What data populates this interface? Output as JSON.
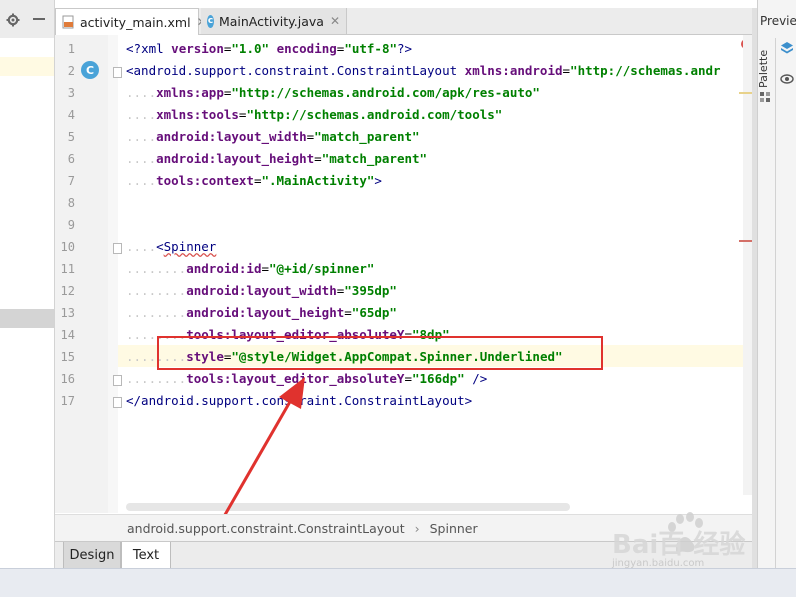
{
  "tabs": [
    {
      "label": "activity_main.xml",
      "icon": "xml-file-icon",
      "active": true
    },
    {
      "label": "MainActivity.java",
      "icon": "class-file-icon",
      "active": false
    }
  ],
  "right_panel": {
    "preview_label": "Previe",
    "palette_label": "Palette"
  },
  "gutter": {
    "class_badge": "C",
    "error_badge": "!"
  },
  "lines": [
    {
      "n": "1"
    },
    {
      "n": "2"
    },
    {
      "n": "3"
    },
    {
      "n": "4"
    },
    {
      "n": "5"
    },
    {
      "n": "6"
    },
    {
      "n": "7"
    },
    {
      "n": "8"
    },
    {
      "n": "9"
    },
    {
      "n": "10"
    },
    {
      "n": "11"
    },
    {
      "n": "12"
    },
    {
      "n": "13"
    },
    {
      "n": "14"
    },
    {
      "n": "15"
    },
    {
      "n": "16"
    },
    {
      "n": "17"
    }
  ],
  "code": {
    "l1": {
      "open": "<?",
      "tag": "xml",
      "a1": "version",
      "v1": "\"1.0\"",
      "a2": "encoding",
      "v2": "\"utf-8\"",
      "close": "?>"
    },
    "l2": {
      "open": "<",
      "tag": "android.support.constraint.ConstraintLayout",
      "attr": "xmlns:android",
      "val": "\"http://schemas.andr"
    },
    "l3": {
      "attr": "xmlns:app",
      "val": "\"http://schemas.android.com/apk/res-auto\""
    },
    "l4": {
      "attr": "xmlns:tools",
      "val": "\"http://schemas.android.com/tools\""
    },
    "l5": {
      "attr": "android:layout_width",
      "val": "\"match_parent\""
    },
    "l6": {
      "attr": "android:layout_height",
      "val": "\"match_parent\""
    },
    "l7": {
      "attr": "tools:context",
      "val": "\".MainActivity\"",
      "close": ">"
    },
    "l10": {
      "open": "<",
      "tag": "Spinner"
    },
    "l11": {
      "attr": "android:id",
      "val": "\"@+id/spinner\""
    },
    "l12": {
      "attr": "android:layout_width",
      "val": "\"395dp\""
    },
    "l13": {
      "attr": "android:layout_height",
      "val": "\"65dp\""
    },
    "l14": {
      "attr": "tools:layout_editor_absoluteY",
      "val": "\"8dp\""
    },
    "l15": {
      "attr": "style",
      "val": "\"@style/Widget.AppCompat.Spinner.Underlined\""
    },
    "l16": {
      "attr": "tools:layout_editor_absoluteY",
      "val": "\"166dp\"",
      "close": " />"
    },
    "l17": {
      "text": "</android.support.constraint.ConstraintLayout>"
    }
  },
  "breadcrumb": {
    "item1": "android.support.constraint.ConstraintLayout",
    "sep": "›",
    "item2": "Spinner"
  },
  "bottom_tabs": {
    "design": "Design",
    "text": "Text"
  },
  "watermark": {
    "logo": "Bai百 经验",
    "url": "jingyan.baidu.com"
  },
  "colors": {
    "highlight_box": "#e0322e",
    "attr": "#660e7a",
    "value": "#008000",
    "tag": "#000080"
  }
}
